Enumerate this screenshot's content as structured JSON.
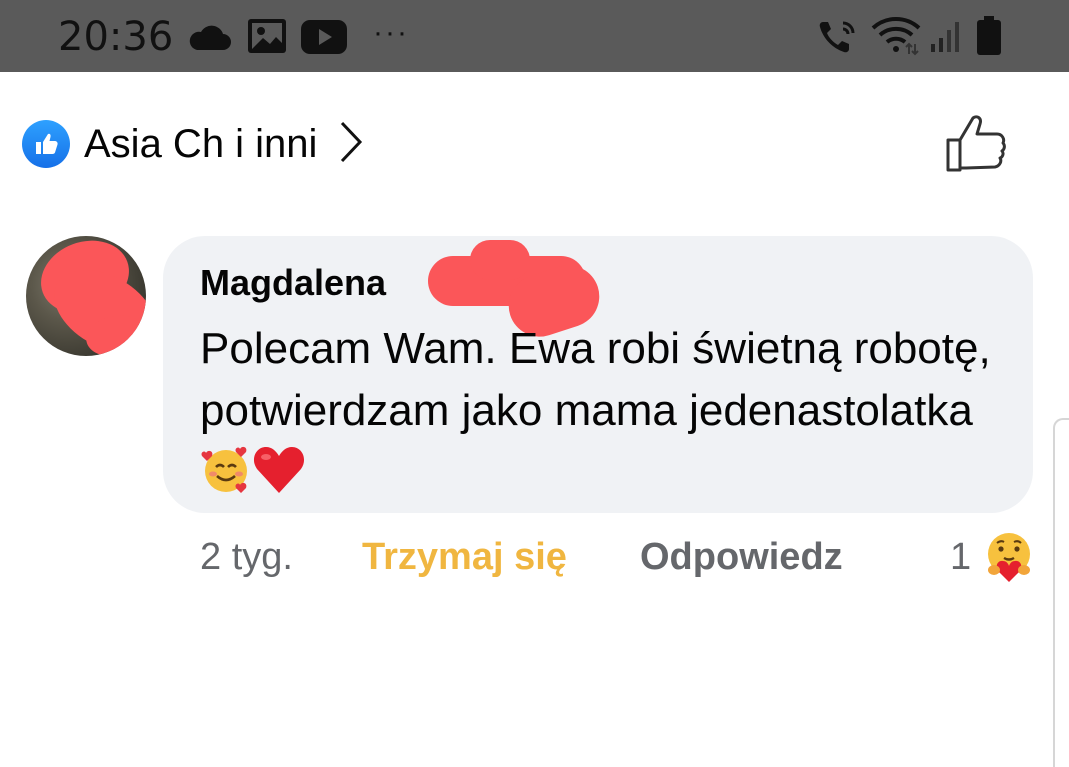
{
  "status_bar": {
    "time": "20:36",
    "icons": [
      "cloud-icon",
      "image-icon",
      "youtube-icon",
      "more-dots-icon",
      "wifi-call-icon",
      "wifi-icon",
      "signal-icon",
      "battery-icon"
    ],
    "more": "···"
  },
  "reactions_header": {
    "names": "Asia Ch i inni",
    "badge_icon": "like-badge-icon",
    "chevron_icon": "chevron-right-icon",
    "like_button_icon": "thumbs-up-outline-icon"
  },
  "comment": {
    "author": "Magdalena",
    "text": "Polecam Wam. Ewa robi świetną robotę, potwierdzam jako mama jedenastolatka",
    "emojis": [
      "smiling-face-with-hearts-icon",
      "red-heart-icon"
    ],
    "time_ago": "2 tyg.",
    "reaction_label": "Trzymaj się",
    "reply_label": "Odpowiedz",
    "reaction_count": "1",
    "reaction_icon": "care-emoji-icon"
  },
  "colors": {
    "status_bar_bg": "#5a5a5a",
    "like_blue": "#1877f2",
    "bubble_bg": "#f0f2f5",
    "care_yellow": "#f0b640",
    "secondary_text": "#65676b",
    "redaction": "#fb5659"
  }
}
